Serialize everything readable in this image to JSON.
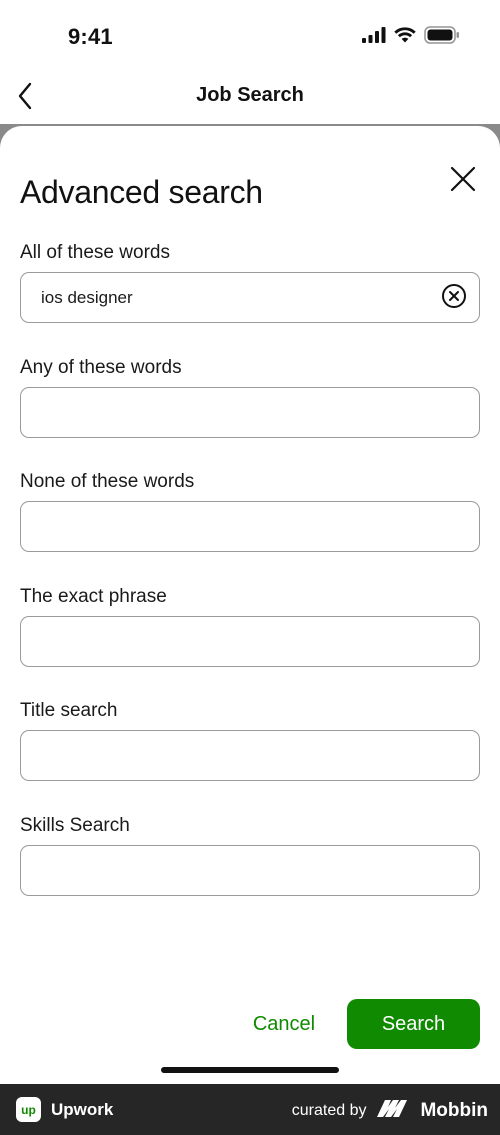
{
  "status_bar": {
    "time": "9:41"
  },
  "nav": {
    "title": "Job Search"
  },
  "sheet": {
    "title": "Advanced search",
    "fields": [
      {
        "label": "All of these words",
        "value": "ios designer",
        "placeholder": ""
      },
      {
        "label": "Any of these words",
        "value": "",
        "placeholder": ""
      },
      {
        "label": "None of these words",
        "value": "",
        "placeholder": ""
      },
      {
        "label": "The exact phrase",
        "value": "",
        "placeholder": ""
      },
      {
        "label": "Title search",
        "value": "",
        "placeholder": ""
      },
      {
        "label": "Skills Search",
        "value": "",
        "placeholder": ""
      }
    ],
    "cancel_label": "Cancel",
    "search_label": "Search"
  },
  "footer": {
    "app_logo_text": "up",
    "app_name": "Upwork",
    "curated_by": "curated by",
    "brand": "Mobbin"
  },
  "colors": {
    "accent": "#108a00",
    "footer_bg": "#262626"
  },
  "icons": {
    "back": "chevron-left-icon",
    "close": "close-icon",
    "clear": "clear-circle-icon",
    "signal": "cellular-signal-icon",
    "wifi": "wifi-icon",
    "battery": "battery-icon"
  }
}
